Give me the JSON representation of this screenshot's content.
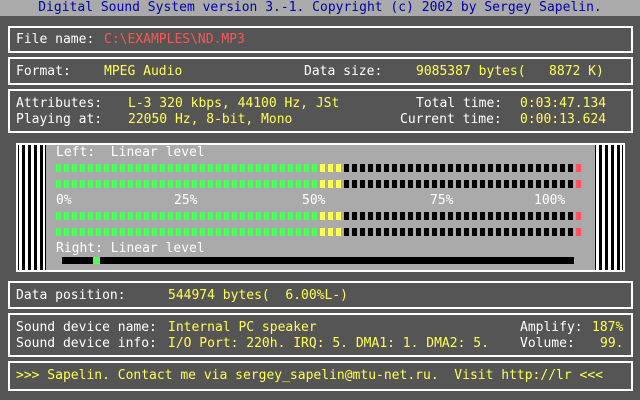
{
  "title": "Digital Sound System version 3.-1. Copyright (c) 2002 by Sergey Sapelin.",
  "file": {
    "label": "File name:",
    "value": "C:\\EXAMPLES\\ND.MP3"
  },
  "format": {
    "label": "Format:",
    "value": "MPEG Audio",
    "size_label": "Data size:",
    "size_value": "9085387 bytes(   8872 K)"
  },
  "attributes": {
    "label": "Attributes:",
    "value": "L-3 320 kbps, 44100 Hz, JSt",
    "total_label": "Total time:",
    "total_value": "0:03:47.134"
  },
  "playing": {
    "label": "Playing at:",
    "value": "22050 Hz, 8-bit, Mono",
    "current_label": "Current time:",
    "current_value": "0:00:13.624"
  },
  "vu": {
    "left_label": "Left:  Linear level",
    "right_label": "Right: Linear level",
    "scale": [
      "0%",
      "25%",
      "50%",
      "75%",
      "100%"
    ],
    "left_level": 0.55,
    "right_level": 0.55,
    "position_fraction": 0.06,
    "colors": {
      "green": "#55ff55",
      "yellow": "#ffff55",
      "dark": "#000000",
      "red": "#ff5555"
    }
  },
  "position": {
    "label": "Data position:",
    "value": "544974 bytes(  6.00%L-)"
  },
  "device": {
    "name_label": "Sound device name:",
    "name_value": "Internal PC speaker",
    "info_label": "Sound device info:",
    "info_value": "I/O Port: 220h. IRQ: 5. DMA1: 1. DMA2: 5.",
    "amplify_label": "Amplify:",
    "amplify_value": "187%",
    "volume_label": "Volume:",
    "volume_value": "99."
  },
  "footer": ">>> Sapelin. Contact me via sergey_sapelin@mtu-net.ru.  Visit http://lr <<<"
}
